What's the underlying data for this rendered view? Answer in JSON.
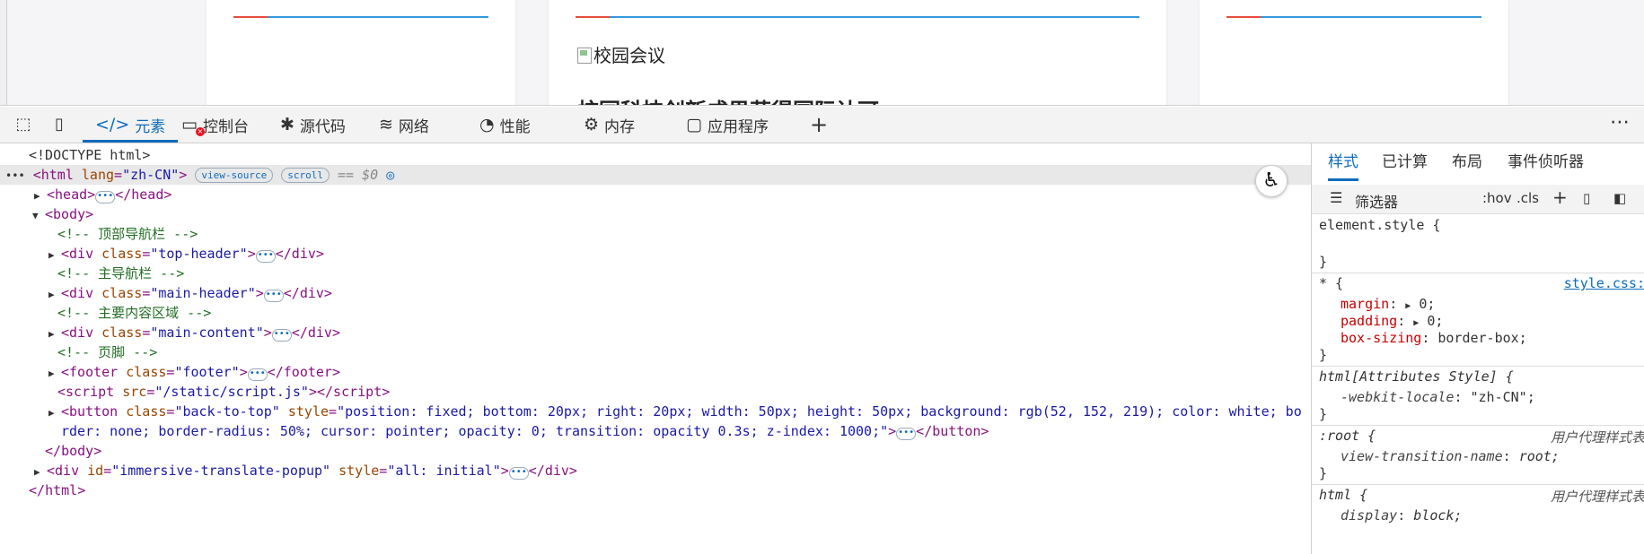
{
  "page": {
    "image_alt": "校园会议",
    "article_title": "校园科技创新成果获得国际认可"
  },
  "devtools": {
    "tabs": [
      {
        "label": "元素",
        "glyph": "</>"
      },
      {
        "label": "控制台",
        "glyph": "▭"
      },
      {
        "label": "源代码",
        "glyph": "✱"
      },
      {
        "label": "网络",
        "glyph": "≋"
      },
      {
        "label": "性能",
        "glyph": "◔"
      },
      {
        "label": "内存",
        "glyph": "⚙"
      },
      {
        "label": "应用程序",
        "glyph": "▢"
      }
    ],
    "add_tab": "+",
    "more": "⋯",
    "console_error_badge": "×"
  },
  "elements": {
    "doctype": "<!DOCTYPE html>",
    "html_open_tag": "html",
    "html_lang_attr": "lang",
    "html_lang_val": "\"zh-CN\"",
    "view_source_pill": "view-source",
    "scroll_pill": "scroll",
    "dollar0": "== $0",
    "head_tag": "head",
    "body_tag": "body",
    "comment_top_header": "<!-- 顶部导航栏 -->",
    "div_top_header_class": "\"top-header\"",
    "comment_main_header": "<!-- 主导航栏 -->",
    "div_main_header_class": "\"main-header\"",
    "comment_main_content": "<!-- 主要内容区域 -->",
    "div_main_content_class": "\"main-content\"",
    "comment_footer": "<!-- 页脚 -->",
    "footer_class": "\"footer\"",
    "script_src": "\"/static/script.js\"",
    "button_class": "\"back-to-top\"",
    "button_style_line1": "\"position: fixed; bottom: 20px; right: 20px; width: 50px; height: 50px; background: rgb(52, 152, 219); color: white; bo",
    "button_style_line2": "rder: none; border-radius: 50%; cursor: pointer; opacity: 0; transition: opacity 0.3s; z-index: 1000;\"",
    "div_popup_id": "\"immersive-translate-popup\"",
    "div_popup_style": "\"all: initial\"",
    "ellipsis": "•••"
  },
  "styles": {
    "tabs": [
      "样式",
      "已计算",
      "布局",
      "事件侦听器"
    ],
    "filter_placeholder": "筛选器",
    "hov": ":hov",
    "cls": ".cls",
    "rules": {
      "element_style_selector": "element.style {",
      "universal_selector": "* {",
      "universal_source": "style.css:",
      "margin_prop": "margin",
      "margin_val": "0;",
      "padding_prop": "padding",
      "padding_val": "0;",
      "boxsizing_prop": "box-sizing",
      "boxsizing_val": "border-box;",
      "html_attr_selector": "html[Attributes Style] {",
      "locale_prop": "-webkit-locale",
      "locale_val": "\"zh-CN\";",
      "root_selector": ":root {",
      "ua_label": "用户代理样式表",
      "vtn_prop": "view-transition-name",
      "vtn_val": "root;",
      "html_selector": "html {",
      "display_prop": "display",
      "display_val": "block;",
      "close_brace": "}"
    }
  },
  "colors": {
    "accent": "#0f6cbd",
    "card_line_blue": "#3498db",
    "card_line_red": "#e74c3c"
  }
}
